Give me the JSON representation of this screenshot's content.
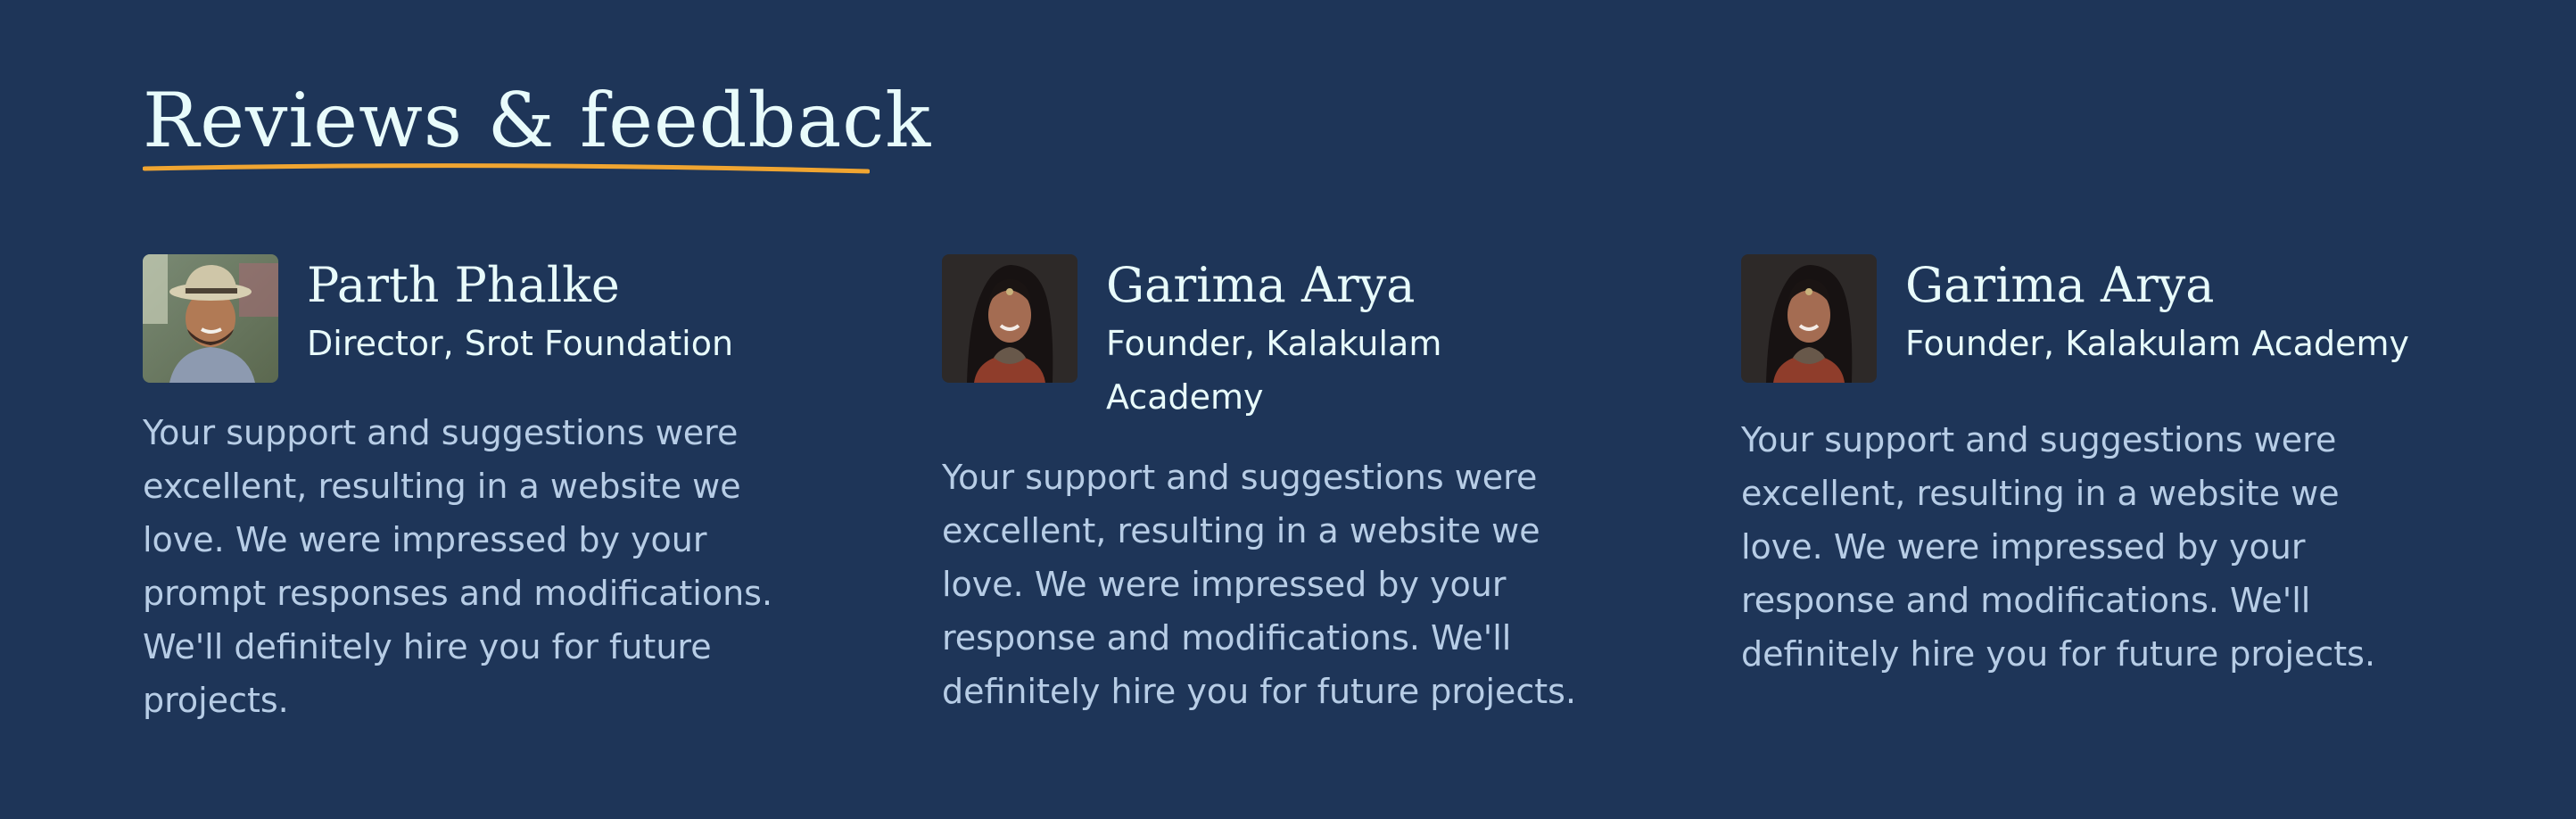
{
  "section": {
    "title": "Reviews & feedback",
    "accent_color": "#f0a531",
    "background_color": "#1e3558"
  },
  "reviews": [
    {
      "name": "Parth Phalke",
      "role": "Director, Srot Foundation",
      "quote": "Your support and suggestions were excellent, resulting in a website we love. We were impressed by your prompt responses and modifications. We'll definitely hire you for future projects.",
      "avatar": "man-with-hat-photo"
    },
    {
      "name": "Garima Arya",
      "role": "Founder, Kalakulam Academy",
      "quote": "Your support and suggestions were excellent, resulting in a website we love. We were impressed by your response and modifications. We'll definitely hire you for future projects.",
      "avatar": "woman-portrait-photo"
    },
    {
      "name": "Garima Arya",
      "role": "Founder, Kalakulam Academy",
      "quote": "Your support and suggestions were excellent, resulting in a website we love. We were impressed by your response and modifications. We'll definitely hire you for future projects.",
      "avatar": "woman-portrait-photo"
    }
  ]
}
